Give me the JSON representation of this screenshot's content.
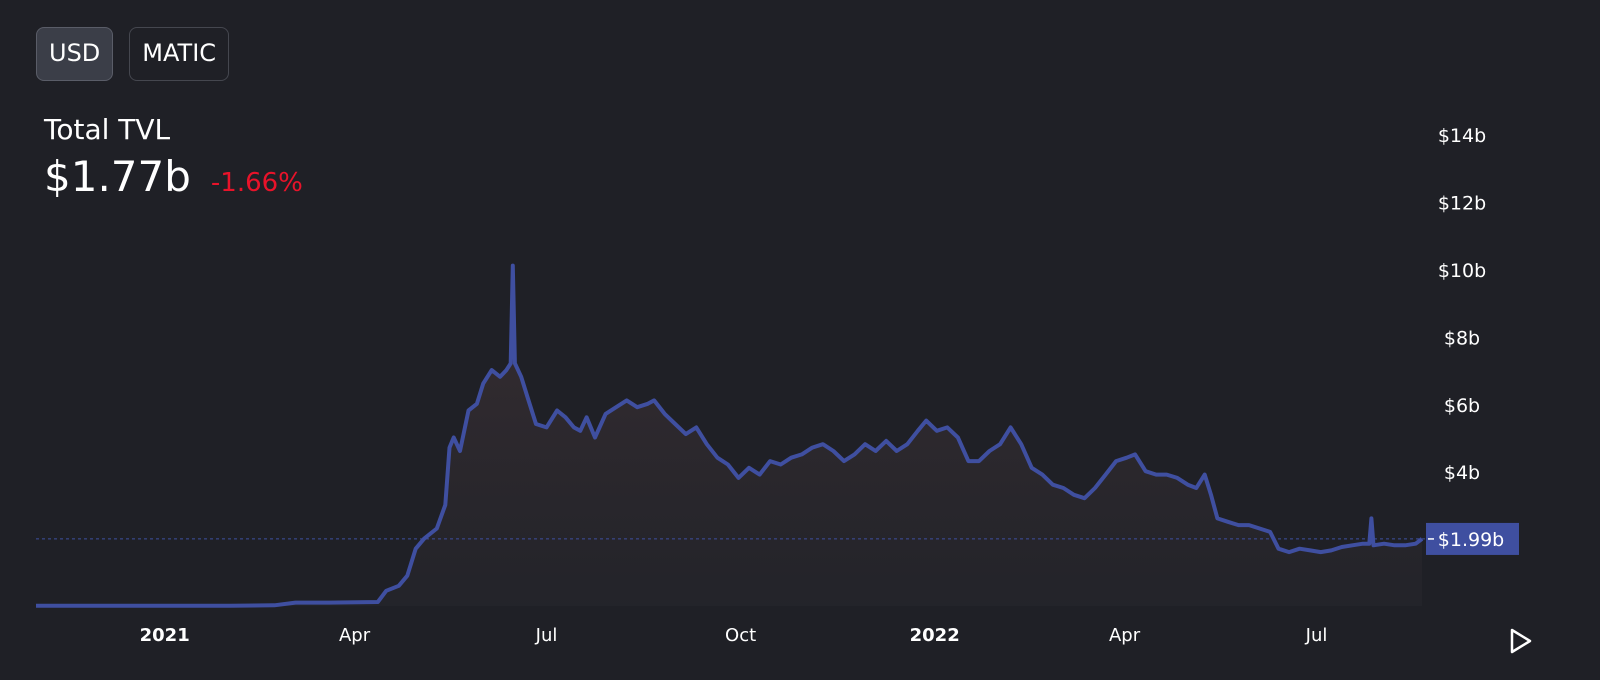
{
  "toggles": [
    {
      "label": "USD",
      "active": true
    },
    {
      "label": "MATIC",
      "active": false
    }
  ],
  "summary": {
    "label": "Total TVL",
    "value": "$1.77b",
    "change": "-1.66%"
  },
  "colors": {
    "background": "#1f2026",
    "line": "#3f4fa0",
    "change_negative": "#e8132a",
    "axis_text": "#ffffff"
  },
  "play_icon": "play-icon",
  "chart_data": {
    "type": "area",
    "y_unit": "USD billions",
    "ylim": [
      0,
      15
    ],
    "y_ticks": [
      {
        "value": 4,
        "label": "$4b"
      },
      {
        "value": 6,
        "label": "$6b"
      },
      {
        "value": 8,
        "label": "$8b"
      },
      {
        "value": 10,
        "label": "$10b"
      },
      {
        "value": 12,
        "label": "$12b"
      },
      {
        "value": 14,
        "label": "$14b"
      }
    ],
    "x_ticks": [
      {
        "date": "2021-01-01",
        "label": "2021"
      },
      {
        "date": "2021-04-01",
        "label": "Apr"
      },
      {
        "date": "2021-07-01",
        "label": "Jul"
      },
      {
        "date": "2021-10-01",
        "label": "Oct"
      },
      {
        "date": "2022-01-01",
        "label": "2022"
      },
      {
        "date": "2022-04-01",
        "label": "Apr"
      },
      {
        "date": "2022-07-01",
        "label": "Jul"
      }
    ],
    "last_value": {
      "value": 1.99,
      "label": "$1.99b"
    },
    "series": [
      {
        "points": [
          [
            "2020-11-01",
            0.01
          ],
          [
            "2020-12-01",
            0.01
          ],
          [
            "2021-01-01",
            0.01
          ],
          [
            "2021-02-01",
            0.01
          ],
          [
            "2021-02-22",
            0.02
          ],
          [
            "2021-03-04",
            0.1
          ],
          [
            "2021-03-20",
            0.1
          ],
          [
            "2021-04-12",
            0.12
          ],
          [
            "2021-04-16",
            0.45
          ],
          [
            "2021-04-22",
            0.6
          ],
          [
            "2021-04-26",
            0.9
          ],
          [
            "2021-04-30",
            1.7
          ],
          [
            "2021-05-04",
            2.0
          ],
          [
            "2021-05-10",
            2.3
          ],
          [
            "2021-05-14",
            3.0
          ],
          [
            "2021-05-16",
            4.7
          ],
          [
            "2021-05-18",
            5.0
          ],
          [
            "2021-05-21",
            4.6
          ],
          [
            "2021-05-25",
            5.8
          ],
          [
            "2021-05-29",
            6.0
          ],
          [
            "2021-06-01",
            6.6
          ],
          [
            "2021-06-05",
            7.0
          ],
          [
            "2021-06-09",
            6.8
          ],
          [
            "2021-06-12",
            7.0
          ],
          [
            "2021-06-14",
            7.2
          ],
          [
            "2021-06-15",
            10.1
          ],
          [
            "2021-06-16",
            7.2
          ],
          [
            "2021-06-19",
            6.8
          ],
          [
            "2021-06-22",
            6.2
          ],
          [
            "2021-06-26",
            5.4
          ],
          [
            "2021-07-01",
            5.3
          ],
          [
            "2021-07-06",
            5.8
          ],
          [
            "2021-07-10",
            5.6
          ],
          [
            "2021-07-14",
            5.3
          ],
          [
            "2021-07-17",
            5.2
          ],
          [
            "2021-07-20",
            5.6
          ],
          [
            "2021-07-24",
            5.0
          ],
          [
            "2021-07-29",
            5.7
          ],
          [
            "2021-08-03",
            5.9
          ],
          [
            "2021-08-08",
            6.1
          ],
          [
            "2021-08-13",
            5.9
          ],
          [
            "2021-08-18",
            6.0
          ],
          [
            "2021-08-21",
            6.1
          ],
          [
            "2021-08-26",
            5.7
          ],
          [
            "2021-08-31",
            5.4
          ],
          [
            "2021-09-05",
            5.1
          ],
          [
            "2021-09-10",
            5.3
          ],
          [
            "2021-09-15",
            4.8
          ],
          [
            "2021-09-20",
            4.4
          ],
          [
            "2021-09-25",
            4.2
          ],
          [
            "2021-09-30",
            3.8
          ],
          [
            "2021-10-05",
            4.1
          ],
          [
            "2021-10-10",
            3.9
          ],
          [
            "2021-10-15",
            4.3
          ],
          [
            "2021-10-20",
            4.2
          ],
          [
            "2021-10-25",
            4.4
          ],
          [
            "2021-10-30",
            4.5
          ],
          [
            "2021-11-04",
            4.7
          ],
          [
            "2021-11-09",
            4.8
          ],
          [
            "2021-11-14",
            4.6
          ],
          [
            "2021-11-19",
            4.3
          ],
          [
            "2021-11-24",
            4.5
          ],
          [
            "2021-11-29",
            4.8
          ],
          [
            "2021-12-04",
            4.6
          ],
          [
            "2021-12-09",
            4.9
          ],
          [
            "2021-12-14",
            4.6
          ],
          [
            "2021-12-19",
            4.8
          ],
          [
            "2021-12-24",
            5.2
          ],
          [
            "2021-12-28",
            5.5
          ],
          [
            "2022-01-02",
            5.2
          ],
          [
            "2022-01-07",
            5.3
          ],
          [
            "2022-01-12",
            5.0
          ],
          [
            "2022-01-17",
            4.3
          ],
          [
            "2022-01-22",
            4.3
          ],
          [
            "2022-01-27",
            4.6
          ],
          [
            "2022-02-01",
            4.8
          ],
          [
            "2022-02-06",
            5.3
          ],
          [
            "2022-02-11",
            4.8
          ],
          [
            "2022-02-16",
            4.1
          ],
          [
            "2022-02-21",
            3.9
          ],
          [
            "2022-02-26",
            3.6
          ],
          [
            "2022-03-03",
            3.5
          ],
          [
            "2022-03-08",
            3.3
          ],
          [
            "2022-03-13",
            3.2
          ],
          [
            "2022-03-18",
            3.5
          ],
          [
            "2022-03-23",
            3.9
          ],
          [
            "2022-03-28",
            4.3
          ],
          [
            "2022-04-02",
            4.4
          ],
          [
            "2022-04-06",
            4.5
          ],
          [
            "2022-04-11",
            4.0
          ],
          [
            "2022-04-16",
            3.9
          ],
          [
            "2022-04-21",
            3.9
          ],
          [
            "2022-04-26",
            3.8
          ],
          [
            "2022-05-01",
            3.6
          ],
          [
            "2022-05-05",
            3.5
          ],
          [
            "2022-05-09",
            3.9
          ],
          [
            "2022-05-12",
            3.3
          ],
          [
            "2022-05-15",
            2.6
          ],
          [
            "2022-05-20",
            2.5
          ],
          [
            "2022-05-25",
            2.4
          ],
          [
            "2022-05-30",
            2.4
          ],
          [
            "2022-06-04",
            2.3
          ],
          [
            "2022-06-09",
            2.2
          ],
          [
            "2022-06-13",
            1.7
          ],
          [
            "2022-06-18",
            1.6
          ],
          [
            "2022-06-23",
            1.7
          ],
          [
            "2022-06-28",
            1.65
          ],
          [
            "2022-07-03",
            1.6
          ],
          [
            "2022-07-08",
            1.65
          ],
          [
            "2022-07-13",
            1.75
          ],
          [
            "2022-07-18",
            1.8
          ],
          [
            "2022-07-23",
            1.85
          ],
          [
            "2022-07-26",
            1.85
          ],
          [
            "2022-07-27",
            2.6
          ],
          [
            "2022-07-28",
            1.8
          ],
          [
            "2022-08-02",
            1.85
          ],
          [
            "2022-08-07",
            1.8
          ],
          [
            "2022-08-12",
            1.8
          ],
          [
            "2022-08-17",
            1.85
          ],
          [
            "2022-08-20",
            1.99
          ]
        ]
      }
    ]
  }
}
